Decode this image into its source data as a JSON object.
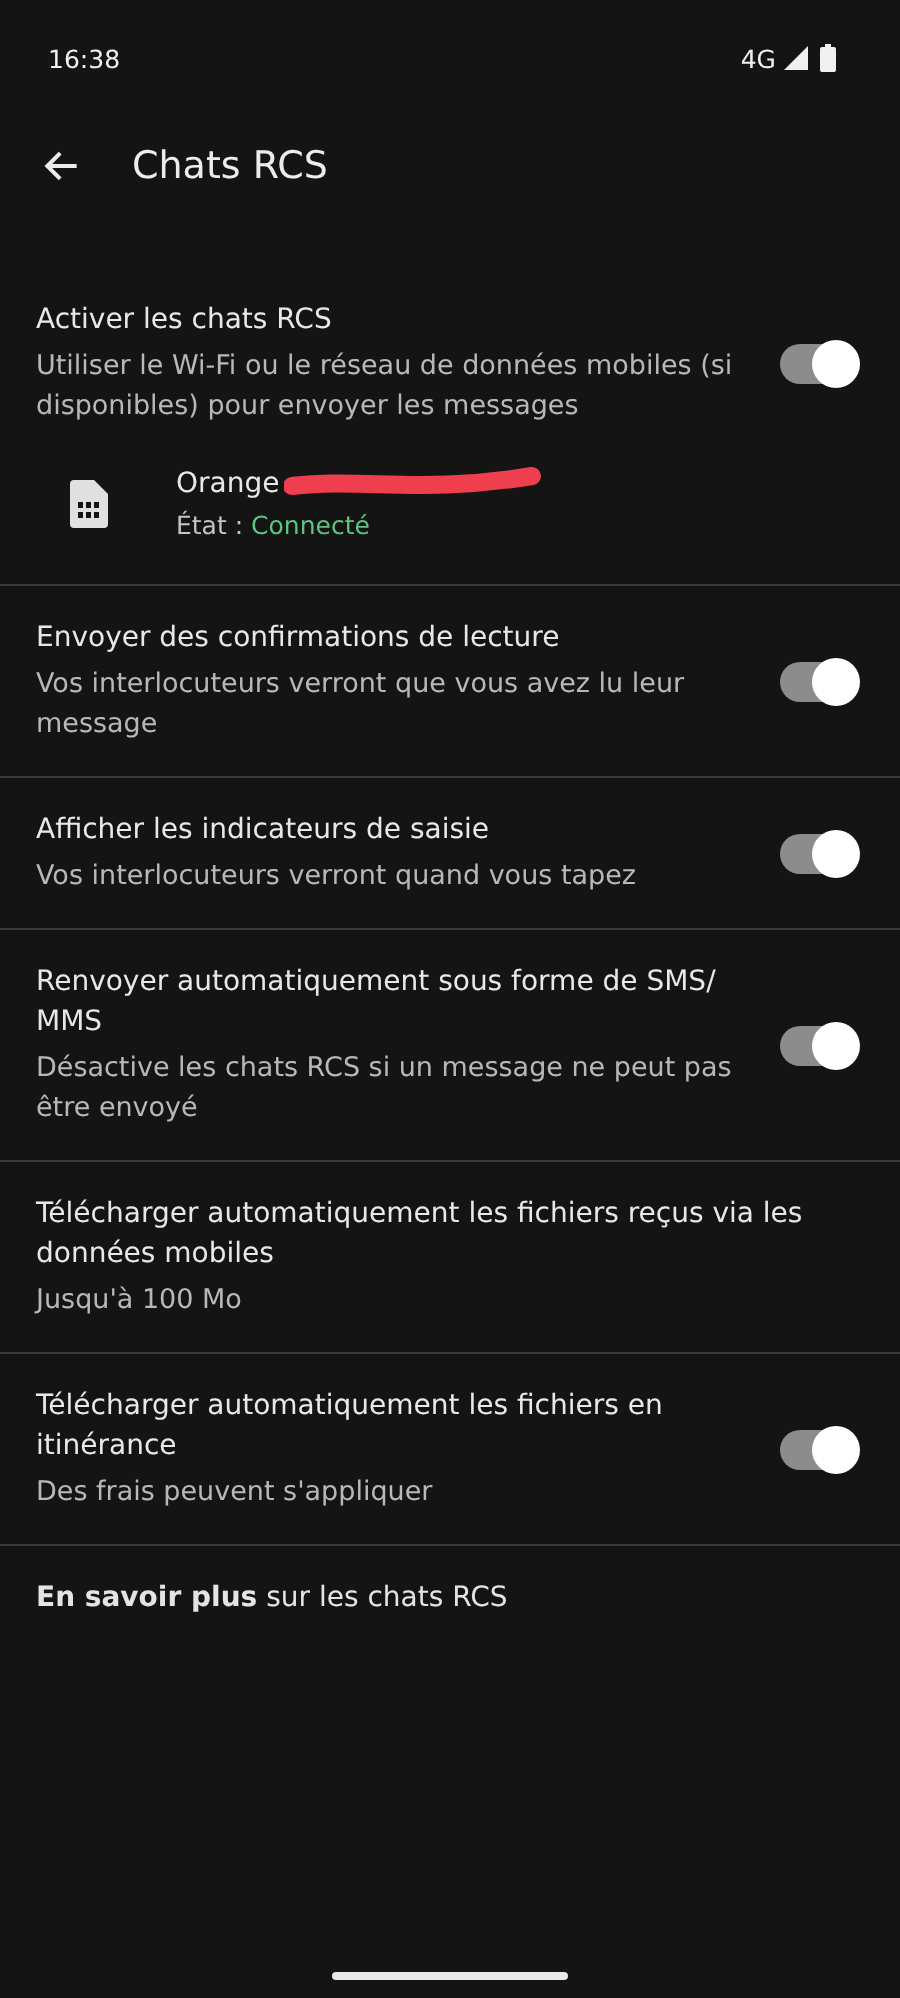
{
  "status_bar": {
    "time": "16:38",
    "network": "4G"
  },
  "header": {
    "title": "Chats RCS"
  },
  "sections": [
    {
      "items": [
        {
          "kind": "toggle",
          "title": "Activer les chats RCS",
          "subtitle": "Utiliser le Wi-Fi ou le réseau de données mobiles (si disponibles) pour envoyer les messages",
          "on": true
        },
        {
          "kind": "sim",
          "name": "Orange",
          "state_label": "État :",
          "state": "Connecté"
        }
      ]
    },
    {
      "items": [
        {
          "kind": "toggle",
          "title": "Envoyer des confirmations de lecture",
          "subtitle": "Vos interlocuteurs verront que vous avez lu leur message",
          "on": true
        }
      ]
    },
    {
      "items": [
        {
          "kind": "toggle",
          "title": "Afficher les indicateurs de saisie",
          "subtitle": "Vos interlocuteurs verront quand vous tapez",
          "on": true
        }
      ]
    },
    {
      "items": [
        {
          "kind": "toggle",
          "title": "Renvoyer automatiquement sous forme de SMS/ MMS",
          "subtitle": "Désactive les chats RCS si un message ne peut pas être envoyé",
          "on": true
        }
      ]
    },
    {
      "items": [
        {
          "kind": "plain",
          "title": "Télécharger automatiquement les fichiers reçus via les données mobiles",
          "subtitle": "Jusqu'à 100 Mo"
        }
      ]
    },
    {
      "items": [
        {
          "kind": "toggle",
          "title": "Télécharger automatiquement les fichiers en itinérance",
          "subtitle": "Des frais peuvent s'appliquer",
          "on": true
        }
      ]
    }
  ],
  "footer_link": "**En savoir plus** sur les chats RCS"
}
